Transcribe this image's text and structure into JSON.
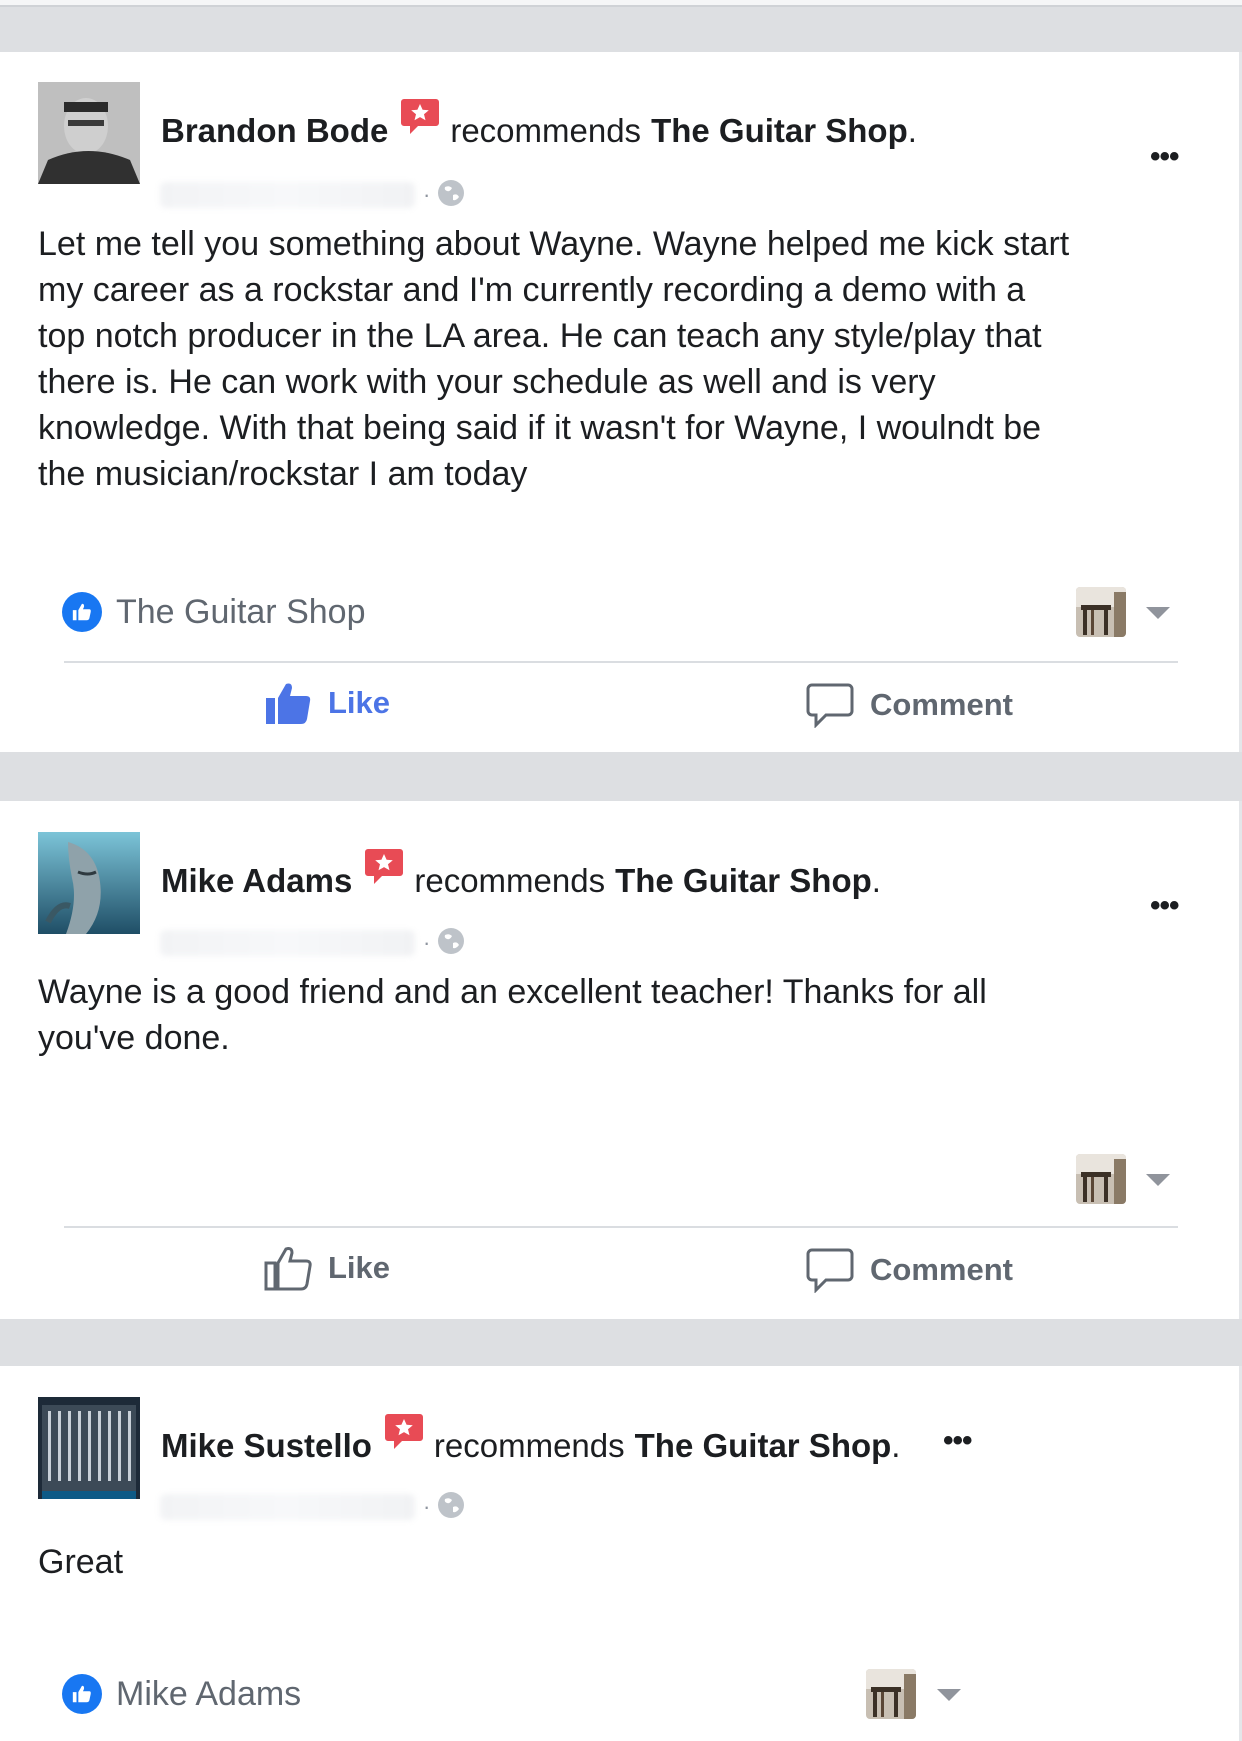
{
  "posts": [
    {
      "author": "Brandon Bode",
      "verb": "recommends",
      "page": "The Guitar Shop",
      "body": "Let me tell you something about Wayne. Wayne helped me kick start\nmy career as a rockstar and I'm currently recording a demo with a\ntop notch producer in the LA area. He can teach any style/play that\nthere is. He can work with your schedule as well and is very\nknowledge. With that being said if it wasn't for Wayne, I woulndt be\nthe musician/rockstar I am today",
      "liked_by": "The Guitar Shop",
      "like_label": "Like",
      "comment_label": "Comment",
      "liked": true
    },
    {
      "author": "Mike Adams",
      "verb": "recommends",
      "page": "The Guitar Shop",
      "body": "Wayne is a good friend and an excellent teacher! Thanks for all\nyou've done.",
      "like_label": "Like",
      "comment_label": "Comment",
      "liked": false
    },
    {
      "author": "Mike Sustello",
      "verb": "recommends",
      "page": "The Guitar Shop",
      "body": "Great",
      "liked_by": "Mike Adams"
    }
  ],
  "more_glyph": "•••",
  "colors": {
    "accent": "#4c74e6",
    "like_blue": "#1877f2",
    "badge_red": "#e84b55",
    "muted": "#606770"
  },
  "icons": [
    "recommend-badge-icon",
    "globe-icon",
    "thumbs-up-icon",
    "comment-icon",
    "caret-down-icon",
    "more-icon"
  ]
}
